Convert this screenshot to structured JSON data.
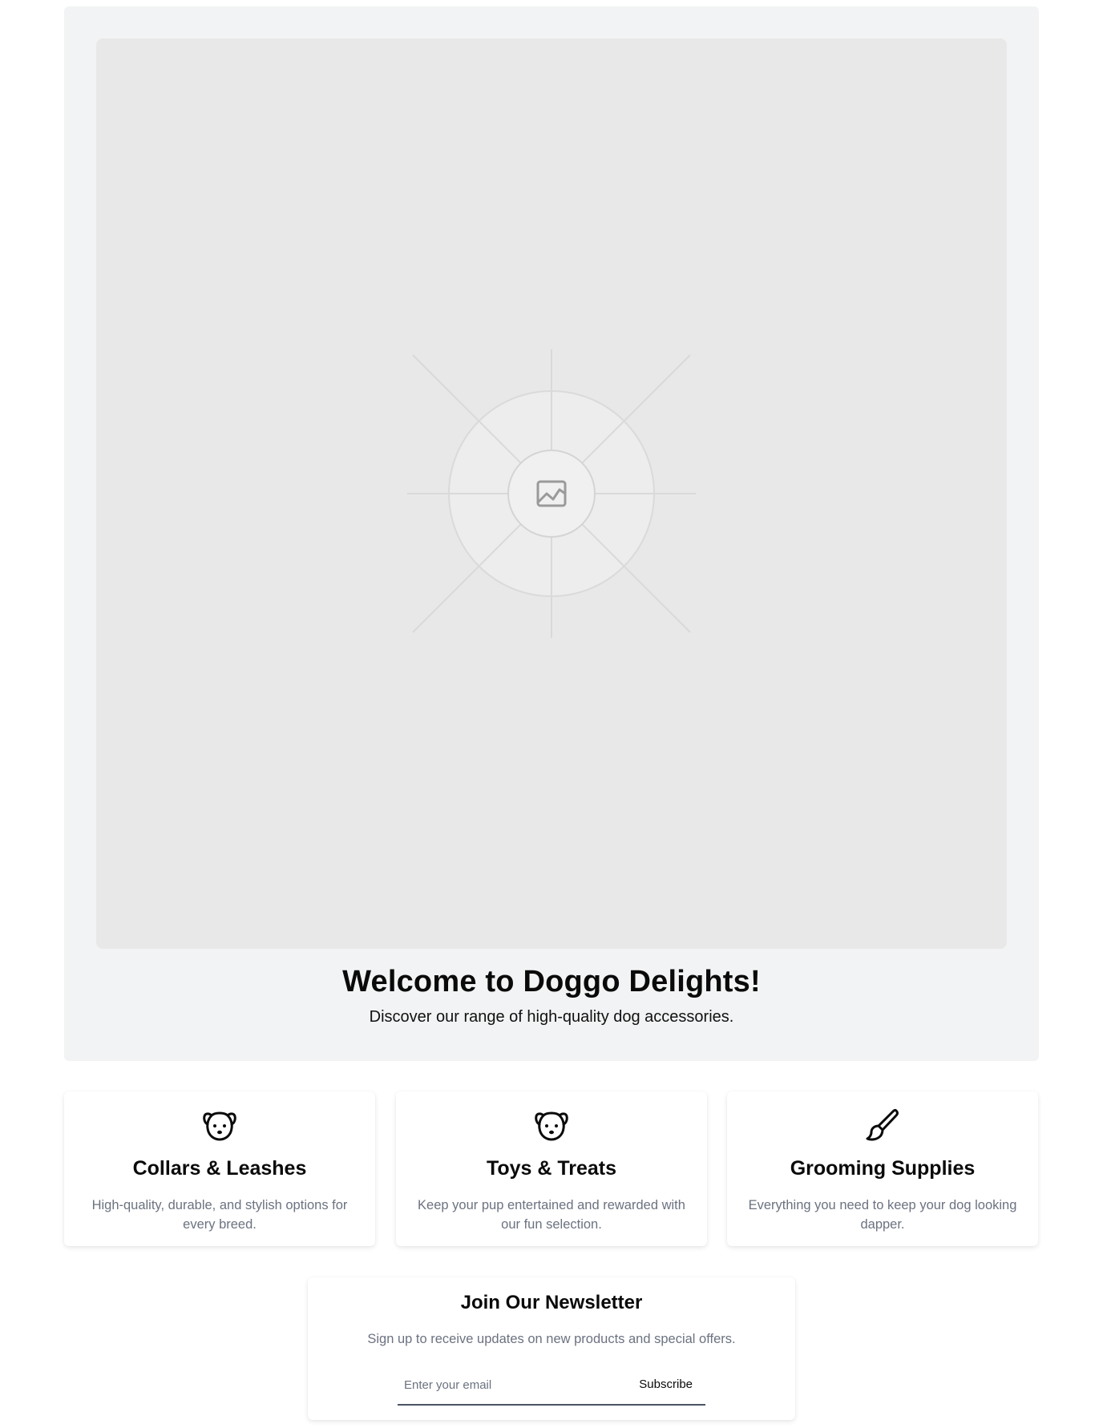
{
  "hero": {
    "image_icon": "image-placeholder-icon",
    "title": "Welcome to Doggo Delights!",
    "subtitle": "Discover our range of high-quality dog accessories."
  },
  "categories": [
    {
      "icon": "dog-icon",
      "title": "Collars & Leashes",
      "description": "High-quality, durable, and stylish options for every breed."
    },
    {
      "icon": "dog-icon",
      "title": "Toys & Treats",
      "description": "Keep your pup entertained and rewarded with our fun selection."
    },
    {
      "icon": "brush-icon",
      "title": "Grooming Supplies",
      "description": "Everything you need to keep your dog looking dapper."
    }
  ],
  "newsletter": {
    "title": "Join Our Newsletter",
    "description": "Sign up to receive updates on new products and special offers.",
    "email_value": "",
    "email_placeholder": "Enter your email",
    "subscribe_label": "Subscribe"
  },
  "colors": {
    "hero_background": "#f2f3f4",
    "image_placeholder": "#e8e8e8",
    "muted_text": "#6b7280",
    "heading_text": "#0a0a0a"
  }
}
